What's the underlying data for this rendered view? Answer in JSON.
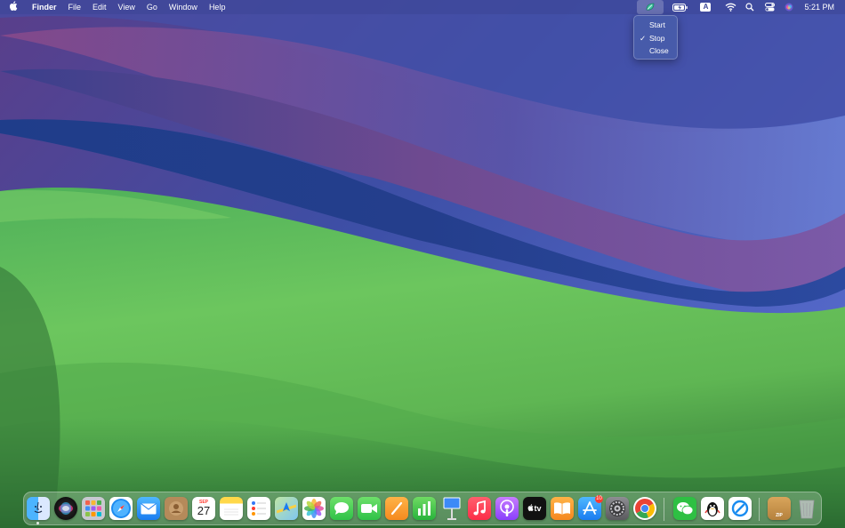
{
  "menubar": {
    "app_name": "Finder",
    "menus": [
      "File",
      "Edit",
      "View",
      "Go",
      "Window",
      "Help"
    ],
    "status_icons": [
      "vpn-app-icon",
      "battery-icon",
      "input-source-icon",
      "wifi-icon",
      "spotlight-search-icon",
      "control-center-icon",
      "siri-icon"
    ],
    "input_source_letter": "A",
    "clock": "5:21 PM"
  },
  "dropdown": {
    "items": [
      {
        "label": "Start",
        "checked": false
      },
      {
        "label": "Stop",
        "checked": true
      },
      {
        "label": "Close",
        "checked": false
      }
    ],
    "checkmark": "✓"
  },
  "dock": {
    "apps": [
      "Finder",
      "Siri",
      "Launchpad",
      "Safari",
      "Mail",
      "Contacts",
      "Calendar",
      "Notes",
      "Reminders",
      "Maps",
      "Photos",
      "Messages",
      "FaceTime",
      "Pages",
      "Numbers",
      "Keynote",
      "Music",
      "Podcasts",
      "TV",
      "Books",
      "App Store",
      "System Settings",
      "Google Chrome",
      "WeChat",
      "QQ",
      "Sync App",
      "Archive",
      "Trash"
    ],
    "calendar_month": "SEP",
    "calendar_day": "27",
    "tv_label": "tv",
    "appstore_badge": "10",
    "archive_label": "ZIP"
  },
  "colors": {
    "accent": "#3478f6",
    "menubar": "#3c4696",
    "badge": "#ff3b30"
  }
}
